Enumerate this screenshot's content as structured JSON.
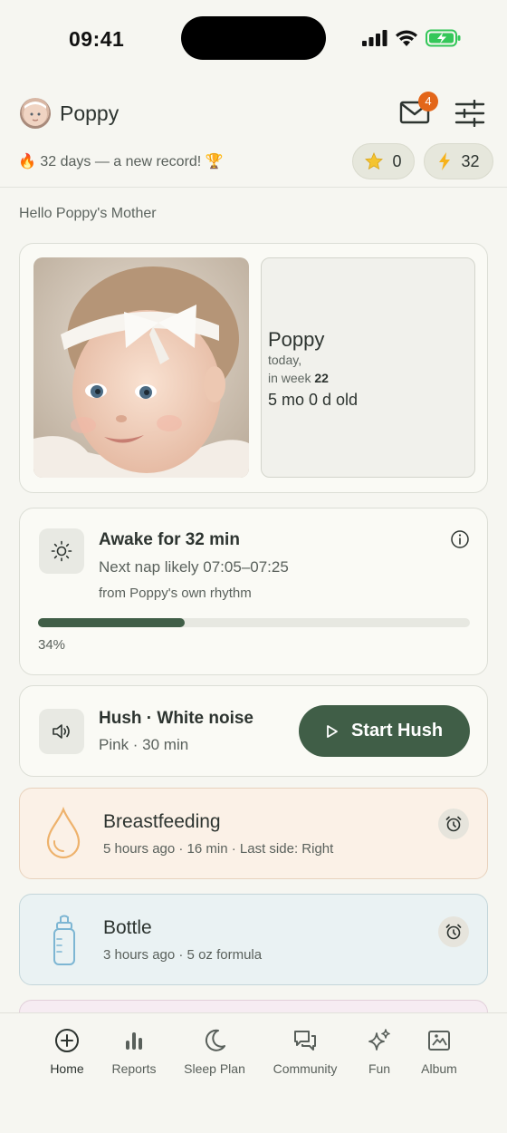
{
  "status_bar": {
    "time": "09:41"
  },
  "header": {
    "child_name": "Poppy",
    "unread_count": "4"
  },
  "streak": {
    "fire": "🔥",
    "text": "32 days — a new record!",
    "trophy": "🏆"
  },
  "pills": {
    "stars": "0",
    "bolts": "32"
  },
  "greeting": "Hello Poppy's Mother",
  "profile": {
    "name": "Poppy",
    "today": "today,",
    "week_prefix": "in week",
    "week": "22",
    "age": "5 mo 0 d old"
  },
  "awake": {
    "title": "Awake for 32 min",
    "next_nap": "Next nap likely 07:05–07:25",
    "source": "from Poppy's own rhythm",
    "progress": 0.34,
    "progress_label": "34%"
  },
  "hush": {
    "title": "Hush · White noise",
    "subtitle": "Pink · 30 min",
    "button": "Start Hush"
  },
  "breastfeeding": {
    "title": "Breastfeeding",
    "subtitle": "5 hours ago · 16 min · Last side: Right"
  },
  "bottle": {
    "title": "Bottle",
    "subtitle": "3 hours ago · 5 oz formula"
  },
  "tabs": [
    {
      "label": "Home",
      "icon": "plus-circle-icon"
    },
    {
      "label": "Reports",
      "icon": "bar-chart-icon"
    },
    {
      "label": "Sleep Plan",
      "icon": "moon-icon"
    },
    {
      "label": "Community",
      "icon": "chat-bubbles-icon"
    },
    {
      "label": "Fun",
      "icon": "sparkles-icon"
    },
    {
      "label": "Album",
      "icon": "photo-icon"
    }
  ],
  "colors": {
    "accent": "#405e47",
    "badge": "#e3661a",
    "breastfeeding_bg": "#fbf1e7",
    "bottle_bg": "#eaf2f3"
  }
}
